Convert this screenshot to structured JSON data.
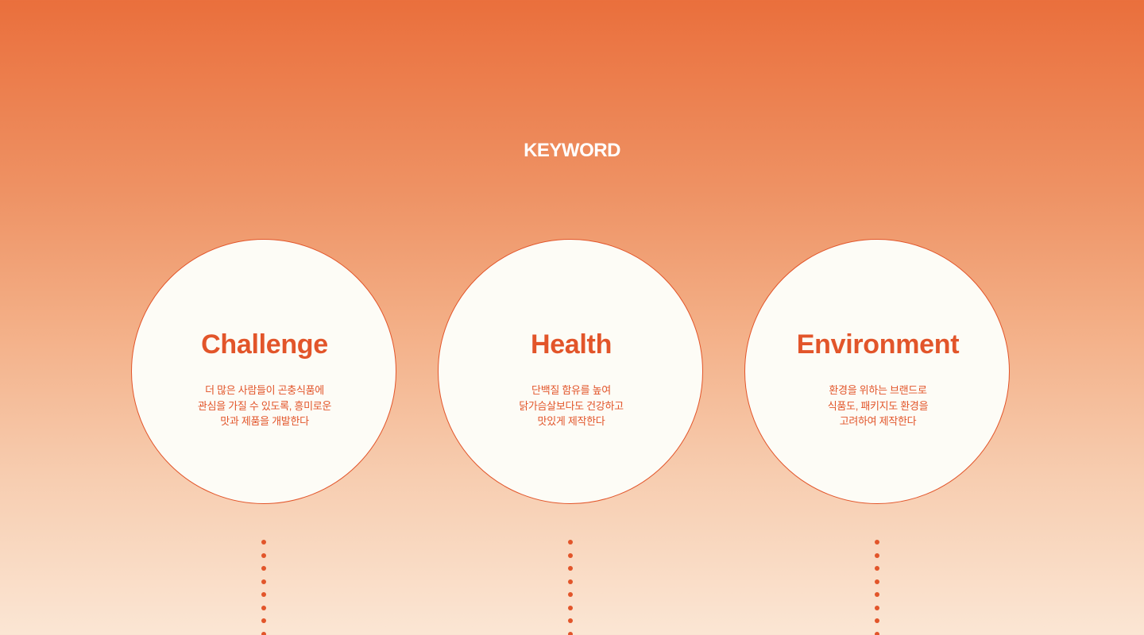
{
  "section": {
    "title": "KEYWORD"
  },
  "keywords": [
    {
      "title": "Challenge",
      "description_lines": [
        "더 많은 사람들이 곤충식품에",
        "관심을 가질 수 있도록, 흥미로운",
        "맛과 제품을 개발한다"
      ]
    },
    {
      "title": "Health",
      "description_lines": [
        "단백질 함유를 높여",
        "닭가슴살보다도 건강하고",
        "맛있게 제작한다"
      ]
    },
    {
      "title": "Environment",
      "description_lines": [
        "환경을 위하는 브랜드로",
        "식품도, 패키지도 환경을",
        "고려하여 제작한다"
      ]
    }
  ],
  "colors": {
    "accent": "#e2552a",
    "circle_fill": "#fdfcf6",
    "gradient_top": "#ea6f3c",
    "gradient_bottom": "#fbe6d4",
    "title_text": "#ffffff"
  }
}
